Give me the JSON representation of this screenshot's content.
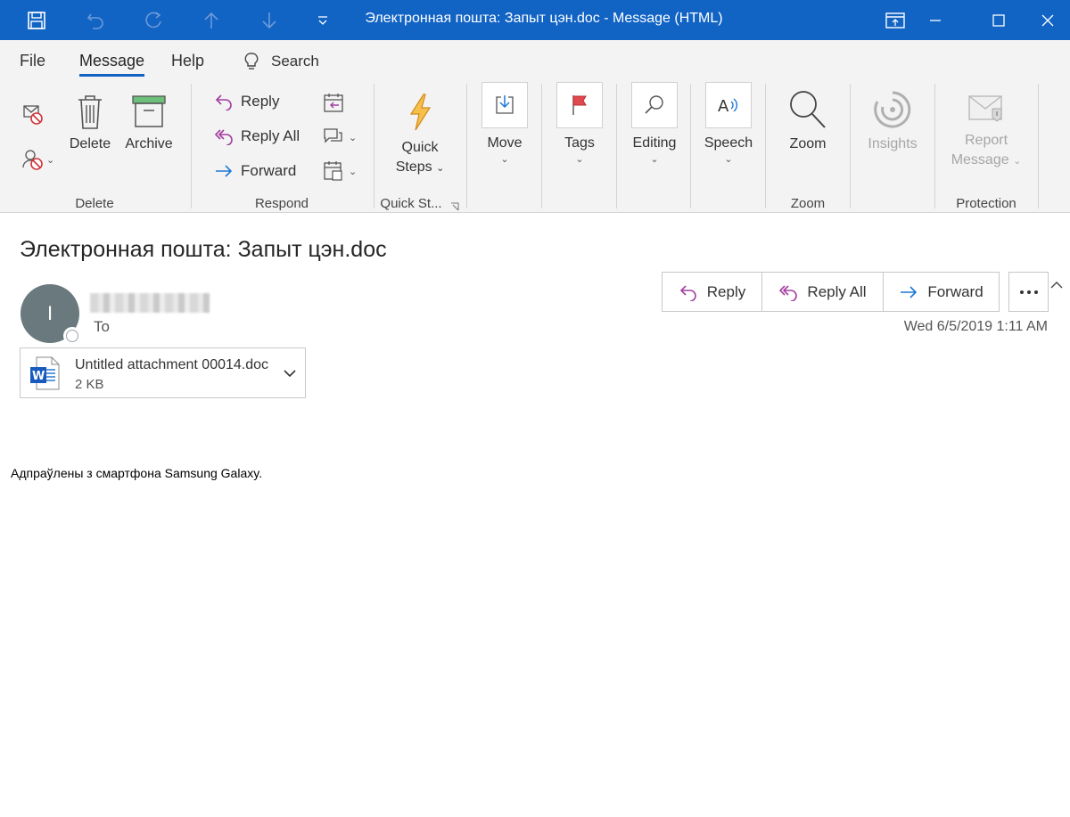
{
  "window": {
    "title": "Электронная пошта: Запыт цэн.doc  -  Message (HTML)"
  },
  "menu": {
    "tabs": [
      {
        "label": "File"
      },
      {
        "label": "Message",
        "active": true
      },
      {
        "label": "Help"
      }
    ],
    "search_label": "Search"
  },
  "ribbon": {
    "groups": {
      "delete": "Delete",
      "respond": "Respond",
      "quick_steps": "Quick St...",
      "zoom": "Zoom",
      "protection": "Protection"
    },
    "buttons": {
      "delete": "Delete",
      "archive": "Archive",
      "reply": "Reply",
      "reply_all": "Reply All",
      "forward": "Forward",
      "quick_steps_line1": "Quick",
      "quick_steps_line2": "Steps",
      "move": "Move",
      "tags": "Tags",
      "editing": "Editing",
      "speech": "Speech",
      "zoom": "Zoom",
      "insights": "Insights",
      "report_line1": "Report",
      "report_line2": "Message"
    }
  },
  "message": {
    "subject": "Электронная пошта: Запыт цэн.doc",
    "avatar_initial": "I",
    "to_label": "To",
    "date": "Wed 6/5/2019 1:11 AM",
    "actions": {
      "reply": "Reply",
      "reply_all": "Reply All",
      "forward": "Forward"
    },
    "attachment": {
      "name": "Untitled attachment 00014.doc",
      "size": "2 KB"
    },
    "body": "Адпраўлены з смартфона Samsung Galaxy."
  },
  "colors": {
    "titlebar": "#1163c4",
    "reply_purple": "#a33ea1",
    "forward_blue": "#1d77d4",
    "avatar": "#69797e"
  }
}
